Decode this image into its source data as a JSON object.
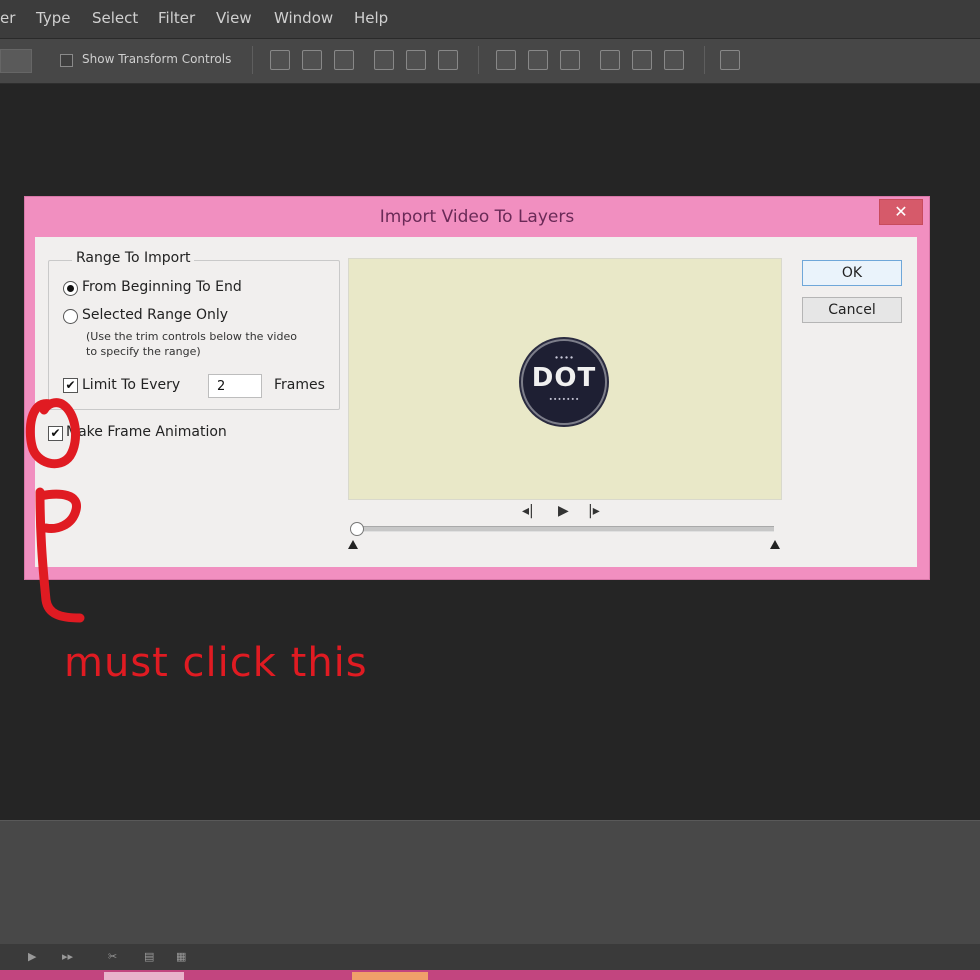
{
  "menu": {
    "items": [
      "er",
      "Type",
      "Select",
      "Filter",
      "View",
      "Window",
      "Help"
    ]
  },
  "options_bar": {
    "show_transform_controls_label": "Show Transform Controls"
  },
  "dialog": {
    "title": "Import Video To Layers",
    "close_label": "✕",
    "range_group_label": "Range To Import",
    "from_beginning_label": "From Beginning To End",
    "selected_range_label": "Selected Range Only",
    "selected_range_note": "(Use the trim controls below the video to specify the range)",
    "limit_label": "Limit To Every",
    "limit_value": "2",
    "frames_label": "Frames",
    "make_frame_animation_label": "Make Frame Animation",
    "ok_label": "OK",
    "cancel_label": "Cancel",
    "from_beginning_selected": true,
    "limit_checked": true,
    "make_frame_animation_checked": true,
    "preview_logo": {
      "big_text": "DOT",
      "top_text": "∙∙∙∙",
      "bottom_text": "∙∙∙∙∙∙∙"
    },
    "transport": {
      "prev": "◂|",
      "play": "▶",
      "next": "|▸"
    }
  },
  "annotation": {
    "text": "must click this",
    "color": "#e01b22"
  }
}
